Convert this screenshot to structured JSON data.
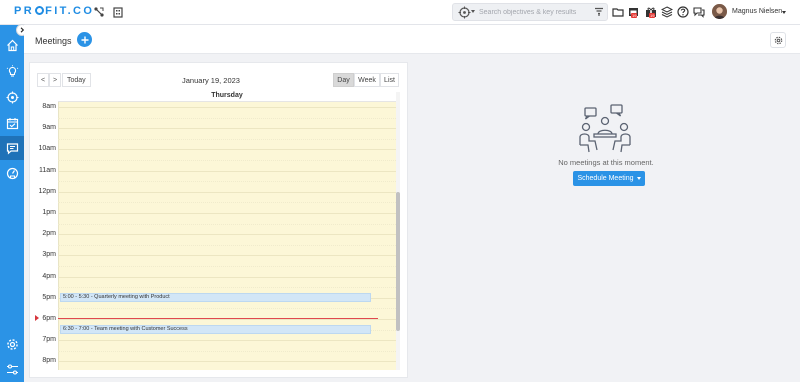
{
  "app": {
    "logo_left": "PR",
    "logo_mid": "O",
    "logo_right": "FIT.CO"
  },
  "search": {
    "placeholder": "Search objectives & key results"
  },
  "notifications": {
    "badge_count": "19"
  },
  "user": {
    "name": "Magnus Nielsen"
  },
  "header": {
    "title": "Meetings"
  },
  "calendar": {
    "prev_label": "<",
    "next_label": ">",
    "today_label": "Today",
    "date": "January 19, 2023",
    "views": {
      "day": "Day",
      "week": "Week",
      "list": "List"
    },
    "active_view": "Day",
    "day_name": "Thursday",
    "hours": [
      "8am",
      "9am",
      "10am",
      "11am",
      "12pm",
      "1pm",
      "2pm",
      "3pm",
      "4pm",
      "5pm",
      "6pm",
      "7pm",
      "8pm"
    ],
    "events": [
      {
        "label": "5:00 - 5:30 - Quarterly meeting with Product"
      },
      {
        "label": "6:30 - 7:00 - Team meeting with Customer Success"
      }
    ]
  },
  "empty_state": {
    "message": "No meetings at this moment.",
    "button_label": "Schedule Meeting"
  },
  "colors": {
    "brand": "#2b93e6",
    "sidebar_active": "#1f72b8",
    "day_column": "#fcf7d7",
    "event_fill": "#d2e6f7",
    "now_indicator": "#e0484e"
  }
}
